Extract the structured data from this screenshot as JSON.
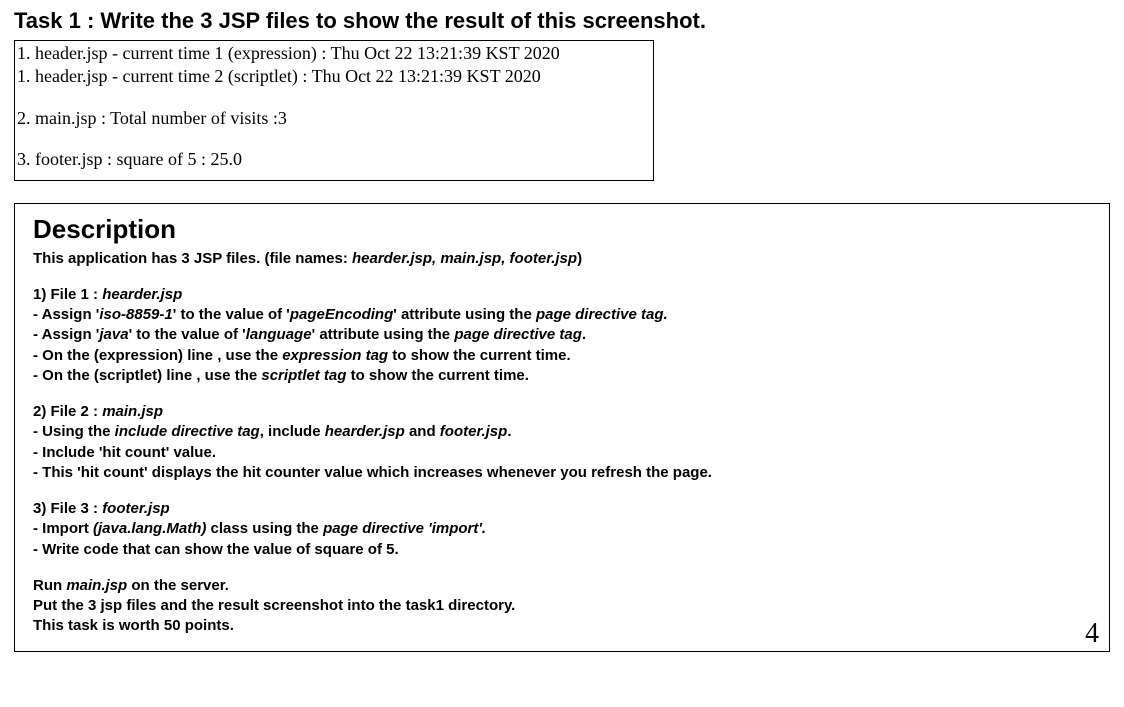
{
  "task_title": "Task 1 : Write the 3 JSP files to show the result of this screenshot.",
  "output": {
    "line1": "1. header.jsp - current time 1 (expression) : Thu Oct 22 13:21:39 KST 2020",
    "line2": "1. header.jsp - current time 2 (scriptlet) : Thu Oct 22 13:21:39 KST 2020",
    "line3": "2. main.jsp : Total number of visits :3",
    "line4": "3. footer.jsp : square of 5 : 25.0"
  },
  "desc": {
    "heading": "Description",
    "intro_a": "This application has 3 JSP files. (file names: ",
    "intro_b": "hearder.jsp, main.jsp, footer.jsp",
    "intro_c": ")",
    "file1": {
      "head_a": "1) File 1 : ",
      "head_b": "hearder.jsp",
      "l1a": "-  Assign  '",
      "l1b": "iso-8859-1",
      "l1c": "' to the value of '",
      "l1d": "pageEncoding",
      "l1e": "' attribute using the ",
      "l1f": "page directive tag.",
      "l2a": "-  Assign '",
      "l2b": "java",
      "l2c": "' to the value of '",
      "l2d": "language",
      "l2e": "' attribute using the ",
      "l2f": "page directive tag",
      "l2g": ".",
      "l3a": "-  On the (expression) line , use the  ",
      "l3b": "expression tag",
      "l3c": " to show the current time.",
      "l4a": "-  On the (scriptlet) line , use the ",
      "l4b": "scriptlet tag",
      "l4c": " to show the current time."
    },
    "file2": {
      "head_a": "2) File 2 : ",
      "head_b": "main.jsp",
      "l1a": "- Using the ",
      "l1b": "include directive tag",
      "l1c": ", include ",
      "l1d": "hearder.jsp",
      "l1e": " and ",
      "l1f": "footer.jsp",
      "l1g": ".",
      "l2": "- Include 'hit count' value.",
      "l3": "- This 'hit count' displays the hit counter value which increases whenever you refresh the page."
    },
    "file3": {
      "head_a": "3) File 3 : ",
      "head_b": "footer.jsp",
      "l1a": "-    Import ",
      "l1b": "(java.lang.Math)",
      "l1c": " class using the ",
      "l1d": "page directive 'import'.",
      "l2": "-    Write code that can show the value of square of 5."
    },
    "run1a": "Run ",
    "run1b": "main.jsp",
    "run1c": " on the server.",
    "run2": "Put the 3 jsp files and the result screenshot into the task1 directory.",
    "run3": "This task is worth 50 points."
  },
  "page_number": "4"
}
